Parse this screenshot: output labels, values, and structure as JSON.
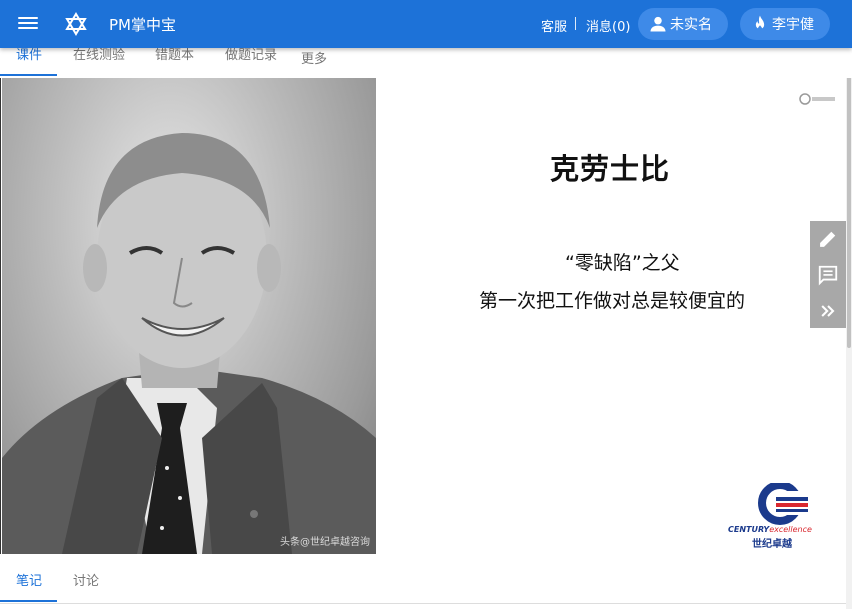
{
  "appbar": {
    "title": "PM掌中宝",
    "service_label": "客服",
    "messages_label": "消息(0)",
    "auth_label": "未实名",
    "user_label": "李宇健",
    "bg_color": "#1d72d8"
  },
  "tabs": [
    {
      "label": "课件",
      "active": true
    },
    {
      "label": "在线测验",
      "active": false
    },
    {
      "label": "错题本",
      "active": false
    },
    {
      "label": "做题记录",
      "active": false
    },
    {
      "label": "更多",
      "active": false
    }
  ],
  "slide": {
    "title": "克劳士比",
    "subtitle_line1": "“零缺陷”之父",
    "subtitle_line2": "第一次把工作做对总是较便宜的",
    "photo_credit": "头条@世纪卓越咨询",
    "brand_wordmark": "CENTURY",
    "brand_wordmark_ex": "excellence",
    "brand_cn": "世纪卓越"
  },
  "tools": [
    {
      "name": "pencil-icon"
    },
    {
      "name": "comment-icon"
    },
    {
      "name": "double-chevron-right-icon"
    }
  ],
  "bottom_tabs": [
    {
      "label": "笔记",
      "active": true
    },
    {
      "label": "讨论",
      "active": false
    }
  ]
}
